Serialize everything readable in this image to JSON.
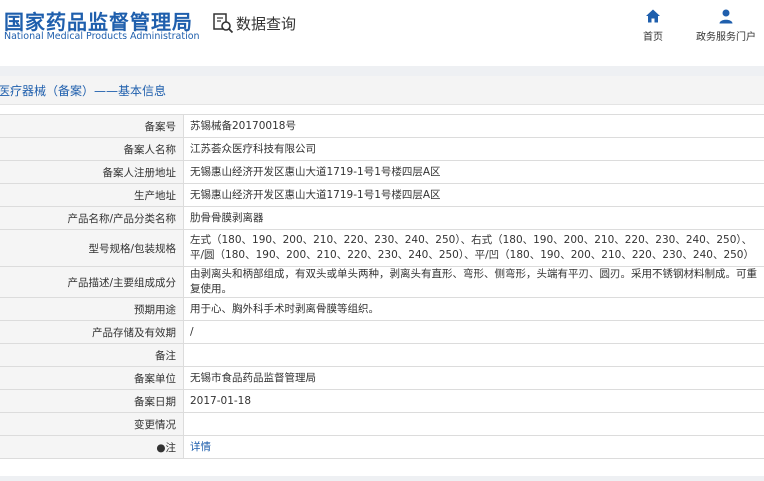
{
  "header": {
    "logo_cn": "国家药品监督管理局",
    "logo_en": "National Medical Products Administration",
    "query_label": "数据查询",
    "nav": {
      "home": "首页",
      "portal": "政务服务门户"
    }
  },
  "section": {
    "title": "医疗器械（备案）——基本信息"
  },
  "rows": [
    {
      "label": "备案号",
      "value": "苏锡械备20170018号"
    },
    {
      "label": "备案人名称",
      "value": "江苏荟众医疗科技有限公司"
    },
    {
      "label": "备案人注册地址",
      "value": "无锡惠山经济开发区惠山大道1719-1号1号楼四层A区"
    },
    {
      "label": "生产地址",
      "value": "无锡惠山经济开发区惠山大道1719-1号1号楼四层A区"
    },
    {
      "label": "产品名称/产品分类名称",
      "value": "肋骨骨膜剥离器"
    },
    {
      "label": "型号规格/包装规格",
      "value": "左式（180、190、200、210、220、230、240、250）、右式（180、190、200、210、220、230、240、250）、平/圆（180、190、200、210、220、230、240、250）、平/凹（180、190、200、210、220、230、240、250）"
    },
    {
      "label": "产品描述/主要组成成分",
      "value": "由剥离头和柄部组成，有双头或单头两种，剥离头有直形、弯形、侧弯形，头端有平刃、圆刃。采用不锈钢材料制成。可重复使用。"
    },
    {
      "label": "预期用途",
      "value": "用于心、胸外科手术时剥离骨膜等组织。"
    },
    {
      "label": "产品存储及有效期",
      "value": "/"
    },
    {
      "label": "备注",
      "value": ""
    },
    {
      "label": "备案单位",
      "value": "无锡市食品药品监督管理局"
    },
    {
      "label": "备案日期",
      "value": "2017-01-18"
    },
    {
      "label": "变更情况",
      "value": ""
    },
    {
      "label": "●注",
      "value": "详情"
    }
  ],
  "colors": {
    "brand": "#1f5fad",
    "label_bg": "#f5f5f5",
    "border": "#dcdcdc"
  }
}
